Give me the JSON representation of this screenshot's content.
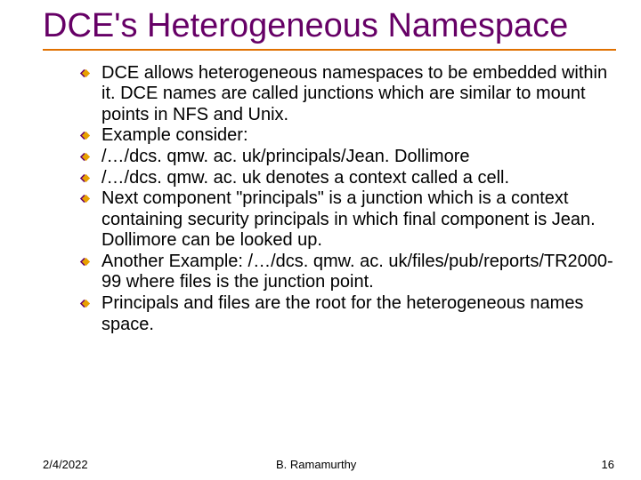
{
  "title": "DCE's Heterogeneous Namespace",
  "bullets": [
    "DCE allows heterogeneous namespaces to be embedded within it. DCE names are called junctions which are similar to mount points in NFS and Unix.",
    "Example consider:",
    "/…/dcs. qmw. ac. uk/principals/Jean. Dollimore",
    "/…/dcs. qmw. ac. uk denotes a context called a cell.",
    "Next component \"principals\" is a junction which is a context containing security principals in which final component is Jean. Dollimore can be looked up.",
    "Another Example: /…/dcs. qmw. ac. uk/files/pub/reports/TR2000-99 where files is the junction point.",
    "Principals and files are the root for the heterogeneous names space."
  ],
  "footer": {
    "date": "2/4/2022",
    "author": "B. Ramamurthy",
    "page": "16"
  }
}
